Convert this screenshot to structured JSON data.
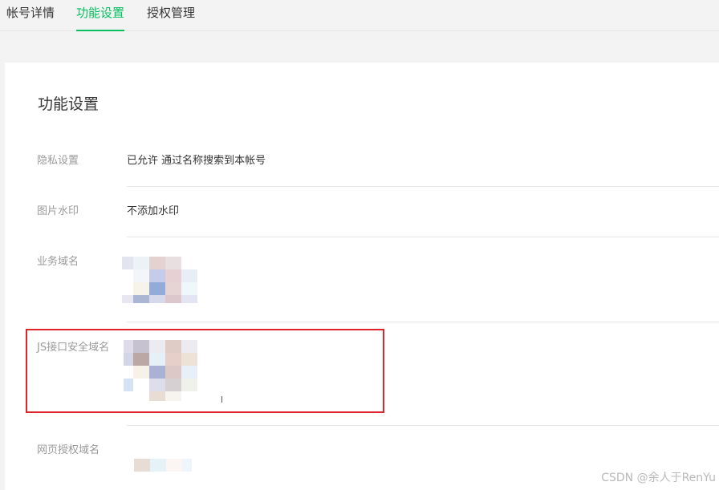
{
  "tabs": [
    {
      "label": "帐号详情",
      "active": false
    },
    {
      "label": "功能设置",
      "active": true
    },
    {
      "label": "授权管理",
      "active": false
    }
  ],
  "card": {
    "title": "功能设置",
    "rows": [
      {
        "label": "隐私设置",
        "value": "已允许 通过名称搜索到本帐号"
      },
      {
        "label": "图片水印",
        "value": "不添加水印"
      },
      {
        "label": "业务域名",
        "value": ""
      },
      {
        "label": "JS接口安全域名",
        "value": ""
      },
      {
        "label": "网页授权域名",
        "value": ""
      }
    ]
  },
  "watermark": "CSDN @余人于RenYu",
  "colors": {
    "accent": "#07c160",
    "highlight": "#e0242a"
  }
}
